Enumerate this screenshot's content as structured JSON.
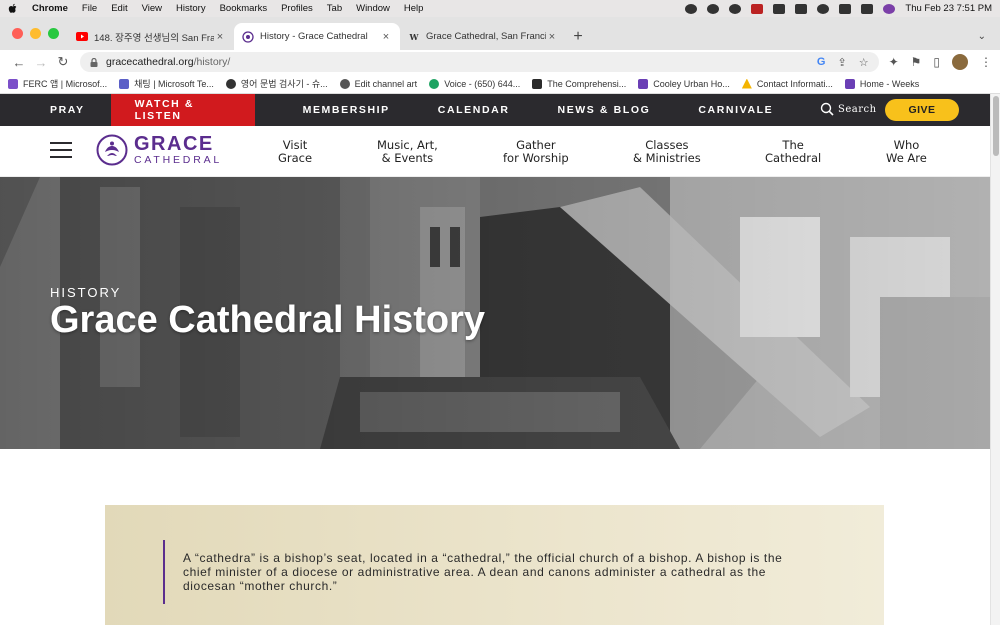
{
  "macos": {
    "app": "Chrome",
    "menus": [
      "File",
      "Edit",
      "View",
      "History",
      "Bookmarks",
      "Profiles",
      "Tab",
      "Window",
      "Help"
    ],
    "clock": "Thu Feb 23  7:51 PM"
  },
  "browser": {
    "tabs": [
      {
        "title": "148. 장주영 선생님의 San Francisco",
        "icon": "youtube-icon",
        "active": false
      },
      {
        "title": "History - Grace Cathedral",
        "icon": "grace-cathedral-icon",
        "active": true
      },
      {
        "title": "Grace Cathedral, San Francisco",
        "icon": "wikipedia-icon",
        "active": false
      }
    ],
    "url_domain": "gracecathedral.org",
    "url_path": "/history/",
    "bookmarks": [
      {
        "label": "FERC 앱 | Microsof...",
        "color": "#7b4fc9"
      },
      {
        "label": "채팅 | Microsoft Te...",
        "color": "#5b5fc7"
      },
      {
        "label": "영어 문법 검사기 - 슈...",
        "color": "#333333"
      },
      {
        "label": "Edit channel art",
        "color": "#555555"
      },
      {
        "label": "Voice - (650) 644...",
        "color": "#1ea362"
      },
      {
        "label": "The Comprehensi...",
        "color": "#2b2b2b"
      },
      {
        "label": "Cooley Urban Ho...",
        "color": "#6a3fb5"
      },
      {
        "label": "Contact Informati...",
        "color": "#f4b400"
      },
      {
        "label": "Home - Weeks",
        "color": "#6a3fb5"
      }
    ]
  },
  "site": {
    "utility_nav": [
      "PRAY",
      "WATCH & LISTEN",
      "MEMBERSHIP",
      "CALENDAR",
      "NEWS & BLOG",
      "CARNIVALE"
    ],
    "search_label": "Search",
    "give_label": "GIVE",
    "logo_line1": "GRACE",
    "logo_line2": "CATHEDRAL",
    "main_nav": [
      {
        "line1": "Visit",
        "line2": "Grace"
      },
      {
        "line1": "Music, Art,",
        "line2": "& Events"
      },
      {
        "line1": "Gather",
        "line2": "for Worship"
      },
      {
        "line1": "Classes",
        "line2": "& Ministries"
      },
      {
        "line1": "The",
        "line2": "Cathedral"
      },
      {
        "line1": "Who",
        "line2": "We Are"
      }
    ],
    "hero_kicker": "HISTORY",
    "hero_title": "Grace Cathedral History",
    "intro_quote": "A “cathedra” is a bishop’s seat, located in a “cathedral,” the official church of a bishop. A bishop is the chief minister of a diocese or administrative area. A dean and canons administer a cathedral as the diocesan “mother church.”",
    "colors": {
      "brand_purple": "#5b2d8e",
      "watch_red": "#d11a1e",
      "give_yellow": "#f8c11b",
      "utility_dark": "#2b2a2e"
    }
  }
}
